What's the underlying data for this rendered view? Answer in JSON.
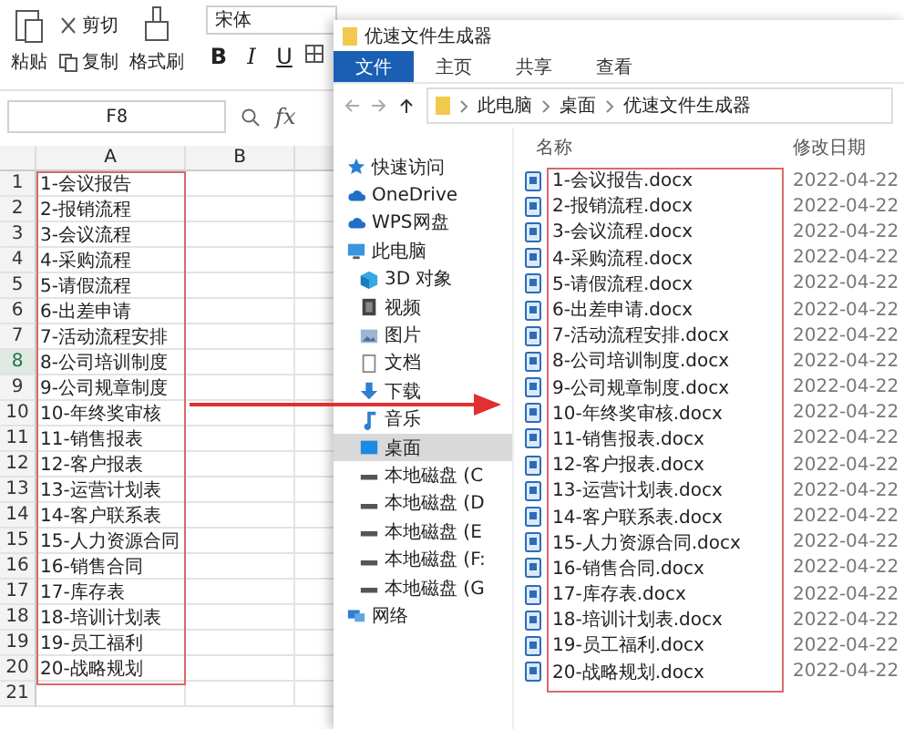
{
  "spreadsheet": {
    "toolbar": {
      "paste": "粘贴",
      "cut": "剪切",
      "copy": "复制",
      "format_painter": "格式刷",
      "font_name": "宋体",
      "bold": "B",
      "italic": "I",
      "underline": "U"
    },
    "name_box": "F8",
    "formula_label": "fx",
    "columns": [
      {
        "label": "A"
      },
      {
        "label": "B"
      }
    ],
    "rows": [
      {
        "number": "1",
        "cell": "1-会议报告",
        "selected": false
      },
      {
        "number": "2",
        "cell": "2-报销流程",
        "selected": false
      },
      {
        "number": "3",
        "cell": "3-会议流程",
        "selected": false
      },
      {
        "number": "4",
        "cell": "4-采购流程",
        "selected": false
      },
      {
        "number": "5",
        "cell": "5-请假流程",
        "selected": false
      },
      {
        "number": "6",
        "cell": "6-出差申请",
        "selected": false
      },
      {
        "number": "7",
        "cell": "7-活动流程安排",
        "selected": false
      },
      {
        "number": "8",
        "cell": "8-公司培训制度",
        "selected": true
      },
      {
        "number": "9",
        "cell": "9-公司规章制度",
        "selected": false
      },
      {
        "number": "10",
        "cell": "10-年终奖审核",
        "selected": false
      },
      {
        "number": "11",
        "cell": "11-销售报表",
        "selected": false
      },
      {
        "number": "12",
        "cell": "12-客户报表",
        "selected": false
      },
      {
        "number": "13",
        "cell": "13-运营计划表",
        "selected": false
      },
      {
        "number": "14",
        "cell": "14-客户联系表",
        "selected": false
      },
      {
        "number": "15",
        "cell": "15-人力资源合同",
        "selected": false
      },
      {
        "number": "16",
        "cell": "16-销售合同",
        "selected": false
      },
      {
        "number": "17",
        "cell": "17-库存表",
        "selected": false
      },
      {
        "number": "18",
        "cell": "18-培训计划表",
        "selected": false
      },
      {
        "number": "19",
        "cell": "19-员工福利",
        "selected": false
      },
      {
        "number": "20",
        "cell": "20-战略规划",
        "selected": false
      },
      {
        "number": "21",
        "selected": false
      }
    ]
  },
  "explorer": {
    "title": "优速文件生成器",
    "tabs": [
      {
        "label": "文件",
        "selected": true
      },
      {
        "label": "主页",
        "selected": false
      },
      {
        "label": "共享",
        "selected": false
      },
      {
        "label": "查看",
        "selected": false
      }
    ],
    "breadcrumb": [
      "此电脑",
      "桌面",
      "优速文件生成器"
    ],
    "nav": [
      {
        "label": "快速访问",
        "kind": "star",
        "selected": false
      },
      {
        "label": "OneDrive",
        "kind": "cloud",
        "selected": false
      },
      {
        "label": "WPS网盘",
        "kind": "cloud",
        "selected": false
      },
      {
        "label": "此电脑",
        "kind": "pc",
        "selected": false,
        "children": [
          {
            "label": "3D 对象",
            "kind": "cube",
            "selected": false
          },
          {
            "label": "视频",
            "kind": "video",
            "selected": false
          },
          {
            "label": "图片",
            "kind": "picture",
            "selected": false
          },
          {
            "label": "文档",
            "kind": "document",
            "selected": false
          },
          {
            "label": "下载",
            "kind": "download",
            "selected": false
          },
          {
            "label": "音乐",
            "kind": "music",
            "selected": false
          },
          {
            "label": "桌面",
            "kind": "desktop",
            "selected": true
          },
          {
            "label": "本地磁盘 (C",
            "kind": "drive",
            "selected": false
          },
          {
            "label": "本地磁盘 (D",
            "kind": "drive",
            "selected": false
          },
          {
            "label": "本地磁盘 (E",
            "kind": "drive",
            "selected": false
          },
          {
            "label": "本地磁盘 (F:",
            "kind": "drive",
            "selected": false
          },
          {
            "label": "本地磁盘 (G",
            "kind": "drive",
            "selected": false
          }
        ]
      },
      {
        "label": "网络",
        "kind": "network",
        "selected": false
      }
    ],
    "columns": [
      "名称",
      "修改日期"
    ],
    "files": [
      {
        "name": "1-会议报告.docx",
        "date": "2022-04-22"
      },
      {
        "name": "2-报销流程.docx",
        "date": "2022-04-22"
      },
      {
        "name": "3-会议流程.docx",
        "date": "2022-04-22"
      },
      {
        "name": "4-采购流程.docx",
        "date": "2022-04-22"
      },
      {
        "name": "5-请假流程.docx",
        "date": "2022-04-22"
      },
      {
        "name": "6-出差申请.docx",
        "date": "2022-04-22"
      },
      {
        "name": "7-活动流程安排.docx",
        "date": "2022-04-22"
      },
      {
        "name": "8-公司培训制度.docx",
        "date": "2022-04-22"
      },
      {
        "name": "9-公司规章制度.docx",
        "date": "2022-04-22"
      },
      {
        "name": "10-年终奖审核.docx",
        "date": "2022-04-22"
      },
      {
        "name": "11-销售报表.docx",
        "date": "2022-04-22"
      },
      {
        "name": "12-客户报表.docx",
        "date": "2022-04-22"
      },
      {
        "name": "13-运营计划表.docx",
        "date": "2022-04-22"
      },
      {
        "name": "14-客户联系表.docx",
        "date": "2022-04-22"
      },
      {
        "name": "15-人力资源合同.docx",
        "date": "2022-04-22"
      },
      {
        "name": "16-销售合同.docx",
        "date": "2022-04-22"
      },
      {
        "name": "17-库存表.docx",
        "date": "2022-04-22"
      },
      {
        "name": "18-培训计划表.docx",
        "date": "2022-04-22"
      },
      {
        "name": "19-员工福利.docx",
        "date": "2022-04-22"
      },
      {
        "name": "20-战略规划.docx",
        "date": "2022-04-22"
      }
    ]
  }
}
